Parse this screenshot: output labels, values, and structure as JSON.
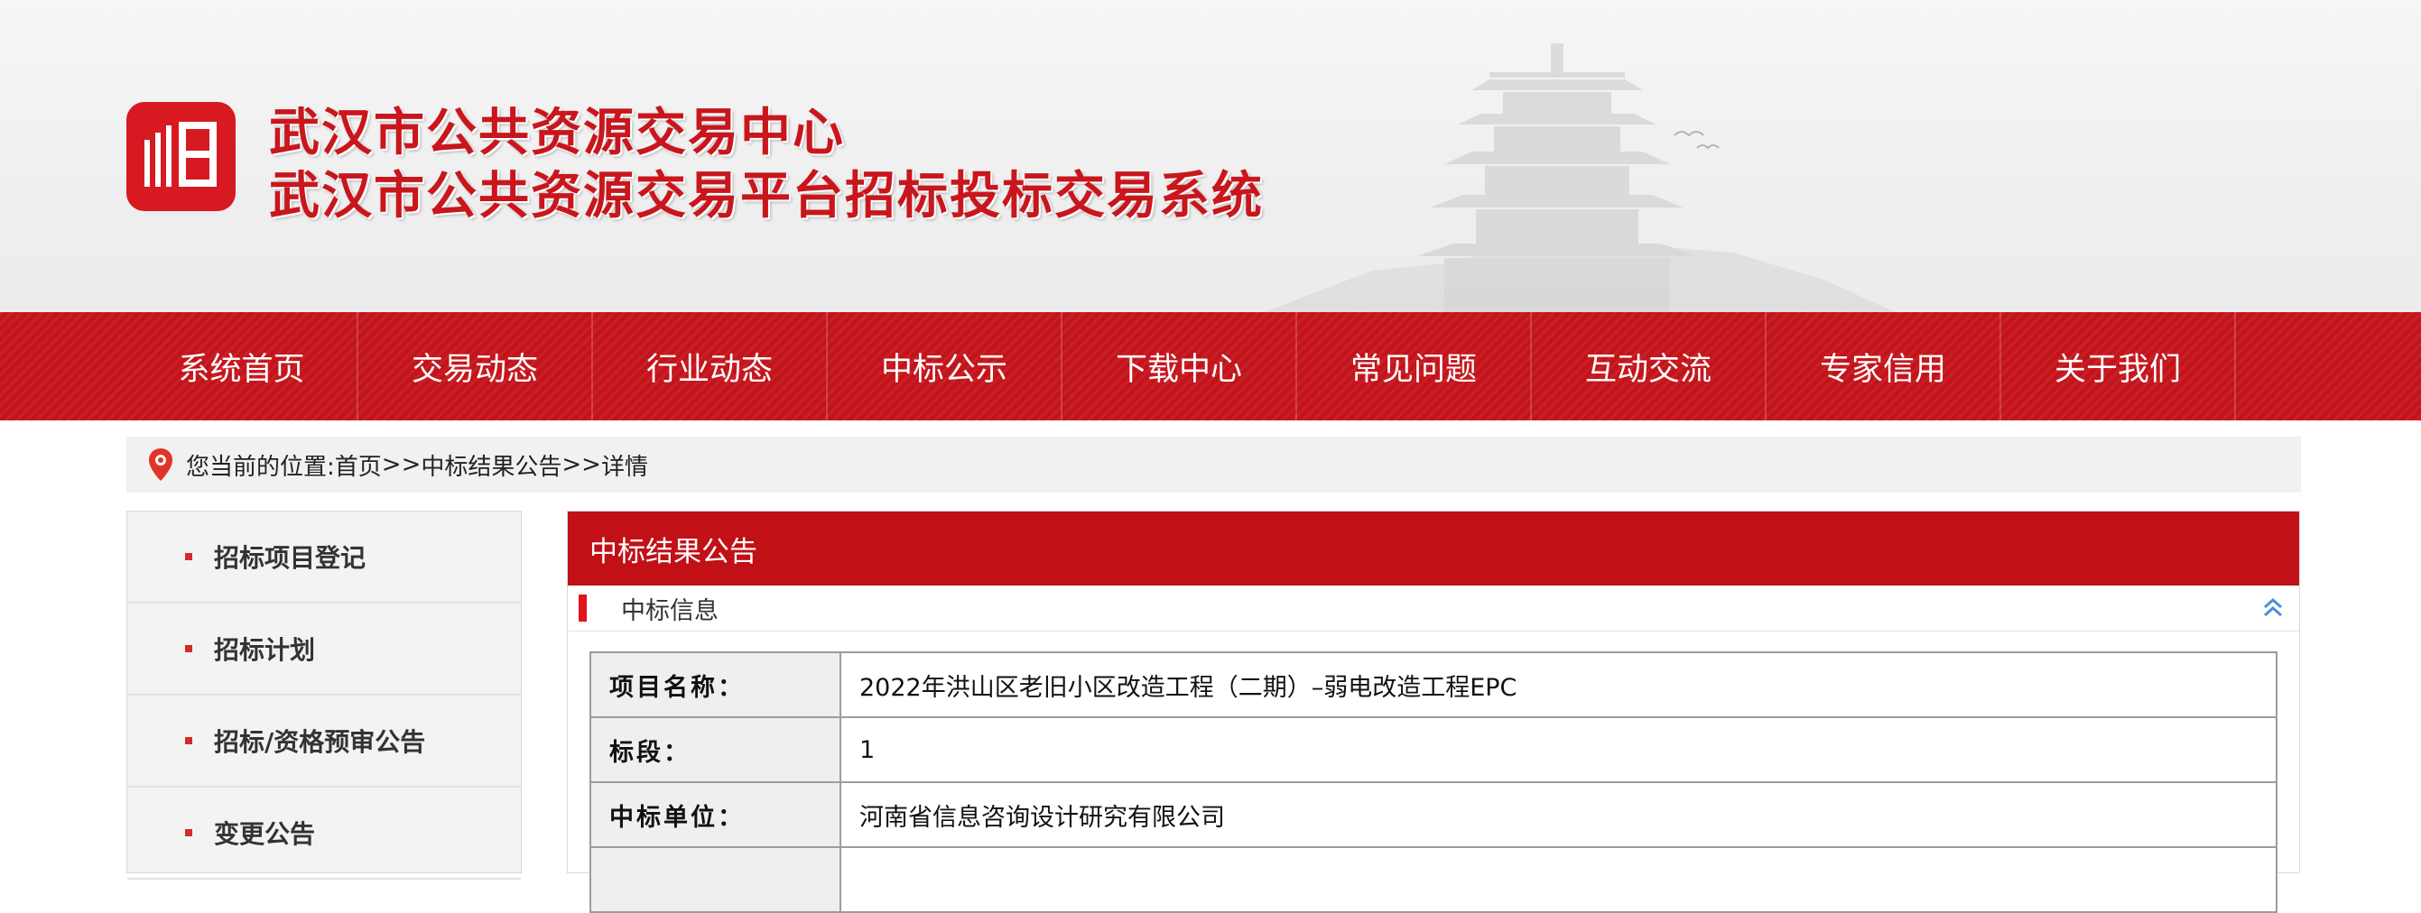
{
  "header": {
    "title_line1": "武汉市公共资源交易中心",
    "title_line2": "武汉市公共资源交易平台招标投标交易系统",
    "brand_color": "#c4141b",
    "logo_icon": "wuhan-ggzy-logo"
  },
  "nav": {
    "items": [
      {
        "label": "系统首页"
      },
      {
        "label": "交易动态"
      },
      {
        "label": "行业动态"
      },
      {
        "label": "中标公示"
      },
      {
        "label": "下载中心"
      },
      {
        "label": "常见问题"
      },
      {
        "label": "互动交流"
      },
      {
        "label": "专家信用"
      },
      {
        "label": "关于我们"
      }
    ]
  },
  "breadcrumb": {
    "icon": "location-pin-icon",
    "prefix": "您当前的位置: ",
    "home": "首页",
    "sep1": ">>",
    "section": "中标结果公告",
    "sep2": ">>",
    "current": "详情"
  },
  "sidebar": {
    "items": [
      {
        "label": "招标项目登记"
      },
      {
        "label": "招标计划"
      },
      {
        "label": "招标/资格预审公告"
      },
      {
        "label": "变更公告"
      }
    ]
  },
  "panel": {
    "title": "中标结果公告",
    "section_title": "中标信息",
    "rows": [
      {
        "key": "项目名称：",
        "value": "2022年洪山区老旧小区改造工程（二期）–弱电改造工程EPC"
      },
      {
        "key": "标段：",
        "value": "1"
      },
      {
        "key": "中标单位：",
        "value": "河南省信息咨询设计研究有限公司"
      },
      {
        "key": "",
        "value": ""
      }
    ]
  }
}
